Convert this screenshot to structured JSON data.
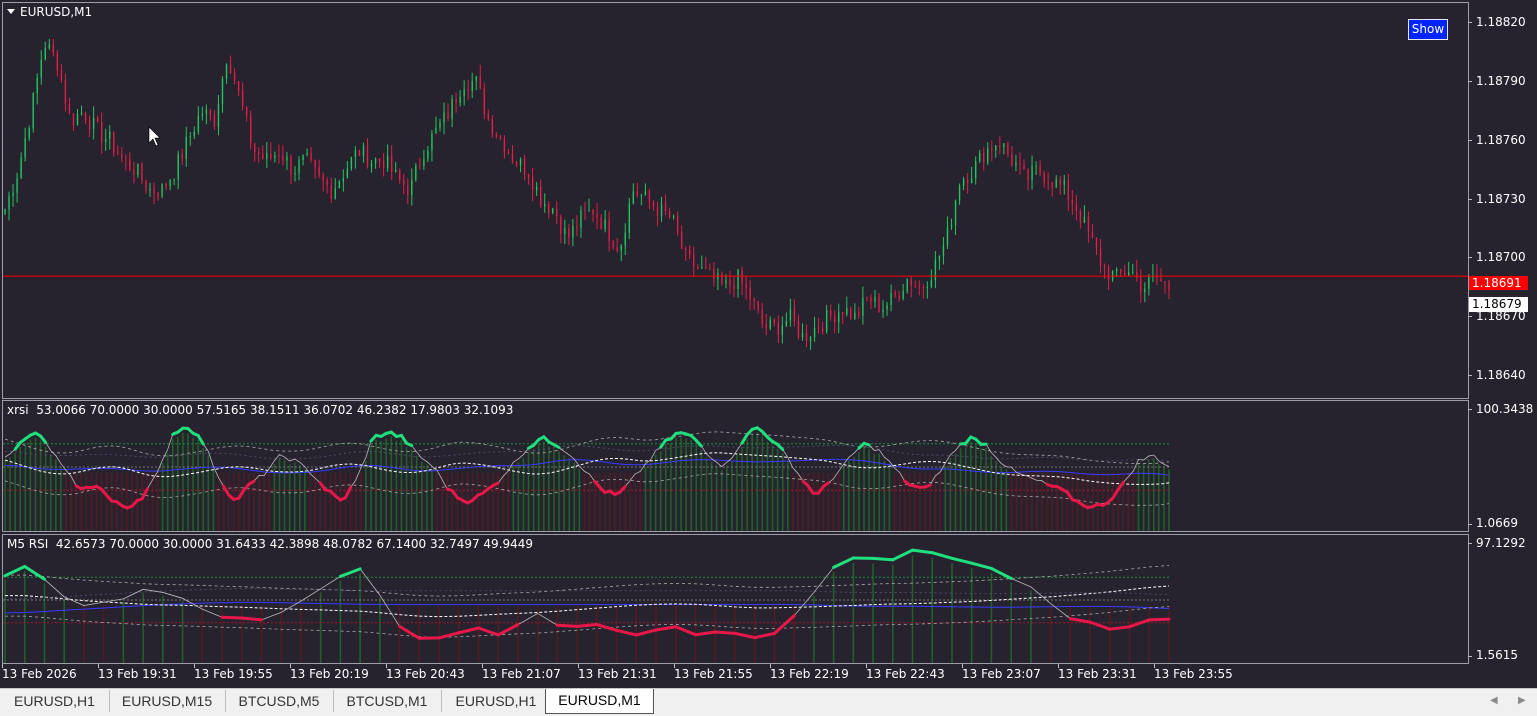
{
  "colors": {
    "bg": "#26222e",
    "bull": "#22c55e",
    "bear": "#e11d48",
    "rsi_up": "#1fe07d",
    "rsi_down": "#e8174a",
    "band_blue": "#3a3aff",
    "price_line": "#ff0000"
  },
  "main": {
    "title": "EURUSD,M1",
    "show_button": "Show",
    "current_price": "1.18691",
    "bid_price": "1.18679",
    "price_labels": [
      "1.18820",
      "1.18790",
      "1.18760",
      "1.18730",
      "1.18700",
      "1.18670",
      "1.18640"
    ],
    "price_values": [
      1.1882,
      1.1879,
      1.1876,
      1.1873,
      1.187,
      1.1867,
      1.1864
    ],
    "price_range": [
      1.18629,
      1.1883
    ],
    "current_value": 1.18691,
    "close_path": [
      1.18725,
      1.18745,
      1.18775,
      1.1881,
      1.188,
      1.1877,
      1.18775,
      1.18765,
      1.1876,
      1.1875,
      1.18745,
      1.18735,
      1.18735,
      1.18745,
      1.1876,
      1.18775,
      1.1877,
      1.18805,
      1.1878,
      1.18755,
      1.1875,
      1.18755,
      1.18745,
      1.1875,
      1.1874,
      1.18735,
      1.18745,
      1.18755,
      1.1875,
      1.1875,
      1.1874,
      1.18735,
      1.18755,
      1.18765,
      1.18775,
      1.1879,
      1.1879,
      1.1877,
      1.1876,
      1.1875,
      1.18745,
      1.1873,
      1.18725,
      1.1871,
      1.1872,
      1.18725,
      1.18715,
      1.18705,
      1.18735,
      1.1873,
      1.18725,
      1.1872,
      1.187,
      1.18695,
      1.1869,
      1.18685,
      1.1869,
      1.1868,
      1.18665,
      1.18665,
      1.1867,
      1.1866,
      1.18665,
      1.1867,
      1.18675,
      1.1867,
      1.1868,
      1.18675,
      1.1868,
      1.1869,
      1.18685,
      1.18695,
      1.1871,
      1.1874,
      1.18745,
      1.18755,
      1.1876,
      1.1875,
      1.1874,
      1.18745,
      1.1874,
      1.18735,
      1.18725,
      1.1871,
      1.18695,
      1.1869,
      1.18695,
      1.18685,
      1.1869,
      1.18685
    ]
  },
  "xrsi": {
    "label": "xrsi  53.0066 70.0000 30.0000 57.5165 38.1511 36.0702 46.2382 17.9803 32.1093",
    "top_value": "100.3438",
    "bottom_value": "1.0669",
    "rsi": [
      60,
      70,
      80,
      65,
      45,
      30,
      35,
      20,
      15,
      25,
      45,
      80,
      85,
      70,
      40,
      20,
      35,
      45,
      60,
      55,
      45,
      30,
      20,
      40,
      75,
      80,
      75,
      60,
      50,
      30,
      20,
      25,
      35,
      50,
      65,
      75,
      70,
      60,
      45,
      30,
      25,
      40,
      55,
      70,
      80,
      75,
      60,
      50,
      70,
      85,
      75,
      60,
      40,
      25,
      40,
      55,
      70,
      65,
      50,
      35,
      30,
      45,
      65,
      75,
      70,
      55,
      45,
      40,
      35,
      30,
      20,
      15,
      20,
      35,
      55,
      60,
      50
    ]
  },
  "rsi5": {
    "label": "M5 RSI  42.6573 70.0000 30.0000 31.6433 42.3898 48.0782 67.1400 32.7497 49.9449",
    "top_value": "97.1292",
    "bottom_value": "1.5615",
    "rsi": [
      72,
      80,
      55,
      45,
      48,
      60,
      58,
      45,
      35,
      30,
      40,
      55,
      70,
      80,
      30,
      15,
      20,
      25,
      20,
      40,
      25,
      30,
      25,
      20,
      30,
      20,
      25,
      15,
      20,
      50,
      80,
      90,
      85,
      95,
      90,
      80,
      75,
      60,
      40,
      30,
      25,
      30,
      35
    ]
  },
  "time_axis": [
    "13 Feb 2026",
    "13 Feb 19:31",
    "13 Feb 19:55",
    "13 Feb 20:19",
    "13 Feb 20:43",
    "13 Feb 21:07",
    "13 Feb 21:31",
    "13 Feb 21:55",
    "13 Feb 22:19",
    "13 Feb 22:43",
    "13 Feb 23:07",
    "13 Feb 23:31",
    "13 Feb 23:55"
  ],
  "tabs": [
    {
      "label": "EURUSD,H1",
      "active": false
    },
    {
      "label": "EURUSD,M15",
      "active": false
    },
    {
      "label": "BTCUSD,M5",
      "active": false
    },
    {
      "label": "BTCUSD,M1",
      "active": false
    },
    {
      "label": "EURUSD,H1",
      "active": false
    },
    {
      "label": "EURUSD,M1",
      "active": true
    }
  ],
  "icons": {
    "scroll_left": "triangle-left-icon",
    "scroll_right": "triangle-right-icon",
    "title_menu": "triangle-down-icon"
  }
}
